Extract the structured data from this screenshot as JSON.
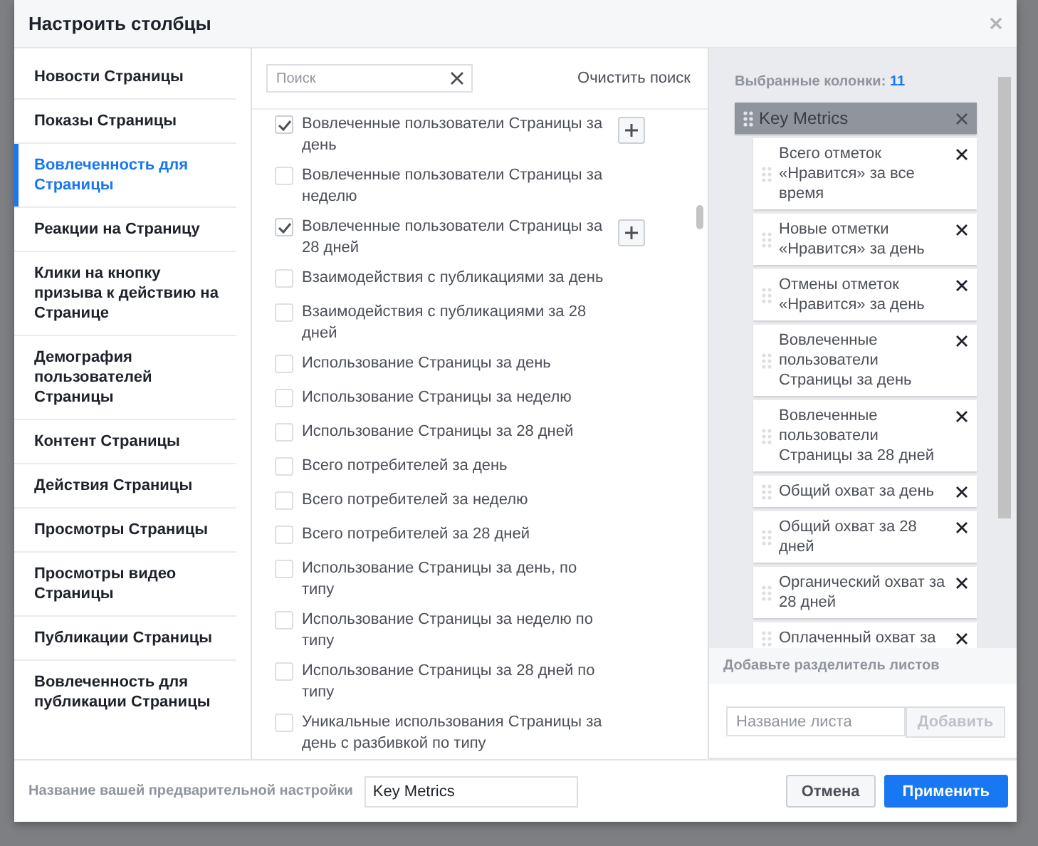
{
  "dialog": {
    "title": "Настроить столбцы"
  },
  "sidebar": {
    "items": [
      {
        "label": "Новости Страницы",
        "selected": false
      },
      {
        "label": "Показы Страницы",
        "selected": false
      },
      {
        "label": "Вовлеченность для Страницы",
        "selected": true
      },
      {
        "label": "Реакции на Страницу",
        "selected": false
      },
      {
        "label": "Клики на кнопку призыва к действию на Странице",
        "selected": false
      },
      {
        "label": "Демография пользователей Страницы",
        "selected": false
      },
      {
        "label": "Контент Страницы",
        "selected": false
      },
      {
        "label": "Действия Страницы",
        "selected": false
      },
      {
        "label": "Просмотры Страницы",
        "selected": false
      },
      {
        "label": "Просмотры видео Страницы",
        "selected": false
      },
      {
        "label": "Публикации Страницы",
        "selected": false
      },
      {
        "label": "Вовлеченность для публикации Страницы",
        "selected": false
      }
    ]
  },
  "search": {
    "placeholder": "Поиск",
    "clear_link": "Очистить поиск"
  },
  "metrics": [
    {
      "label": "Вовлеченные пользователи Страницы за день",
      "checked": true
    },
    {
      "label": "Вовлеченные пользователи Страницы за неделю",
      "checked": false
    },
    {
      "label": "Вовлеченные пользователи Страницы за 28 дней",
      "checked": true
    },
    {
      "label": "Взаимодействия с публикациями за день",
      "checked": false
    },
    {
      "label": "Взаимодействия с публикациями за 28 дней",
      "checked": false
    },
    {
      "label": "Использование Страницы за день",
      "checked": false
    },
    {
      "label": "Использование Страницы за неделю",
      "checked": false
    },
    {
      "label": "Использование Страницы за 28 дней",
      "checked": false
    },
    {
      "label": "Всего потребителей за день",
      "checked": false
    },
    {
      "label": "Всего потребителей за неделю",
      "checked": false
    },
    {
      "label": "Всего потребителей за 28 дней",
      "checked": false
    },
    {
      "label": "Использование Страницы за день, по типу",
      "checked": false
    },
    {
      "label": "Использование Страницы за неделю по типу",
      "checked": false
    },
    {
      "label": "Использование Страницы за 28 дней по типу",
      "checked": false
    },
    {
      "label": "Уникальные использования Страницы за день с разбивкой по типу",
      "checked": false
    }
  ],
  "selected_columns": {
    "title": "Выбранные колонки:",
    "count": "11",
    "groups": [
      {
        "name": "Key Metrics",
        "children": [
          {
            "label": "Всего отметок «Нравится» за все время"
          },
          {
            "label": "Новые отметки «Нравится» за день"
          },
          {
            "label": "Отмены отметок «Нравится» за день"
          },
          {
            "label": "Вовлеченные пользователи Страницы за день"
          },
          {
            "label": "Вовлеченные пользователи Страницы за 28 дней"
          },
          {
            "label": "Общий охват за день"
          },
          {
            "label": "Общий охват за 28 дней"
          },
          {
            "label": "Органический охват за 28 дней"
          },
          {
            "label": "Оплаченный охват за"
          }
        ]
      }
    ]
  },
  "sheet_divider": {
    "heading": "Добавьте разделитель листов",
    "placeholder": "Название листа",
    "button": "Добавить",
    "disabled": true
  },
  "footer": {
    "preset_label": "Название вашей предварительной настройки",
    "preset_value": "Key Metrics",
    "buttons": [
      {
        "label": "Отмена",
        "kind": "secondary"
      },
      {
        "label": "Применить",
        "kind": "primary"
      }
    ]
  }
}
